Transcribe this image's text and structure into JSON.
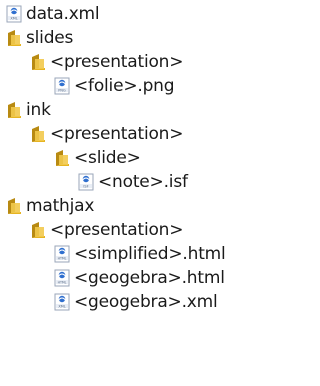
{
  "tree": {
    "items": [
      {
        "label": "data.xml",
        "type": "file",
        "badge": "XML"
      },
      {
        "label": "slides",
        "type": "folder"
      },
      {
        "label": "<presentation>",
        "type": "folder"
      },
      {
        "label": "<folie>.png",
        "type": "file",
        "badge": "PNG"
      },
      {
        "label": "ink",
        "type": "folder"
      },
      {
        "label": "<presentation>",
        "type": "folder"
      },
      {
        "label": "<slide>",
        "type": "folder"
      },
      {
        "label": "<note>.isf",
        "type": "file",
        "badge": "ISF"
      },
      {
        "label": "mathjax",
        "type": "folder"
      },
      {
        "label": "<presentation>",
        "type": "folder"
      },
      {
        "label": "<simplified>.html",
        "type": "file",
        "badge": "HTML"
      },
      {
        "label": "<geogebra>.html",
        "type": "file",
        "badge": "HTML"
      },
      {
        "label": "<geogebra>.xml",
        "type": "file",
        "badge": "XML"
      }
    ]
  },
  "colors": {
    "folder": "#e6b422",
    "folder_dark": "#b88a12",
    "file_accent": "#2f6fcf"
  },
  "icons": {
    "folder": "folder-icon",
    "file": "file-icon"
  }
}
